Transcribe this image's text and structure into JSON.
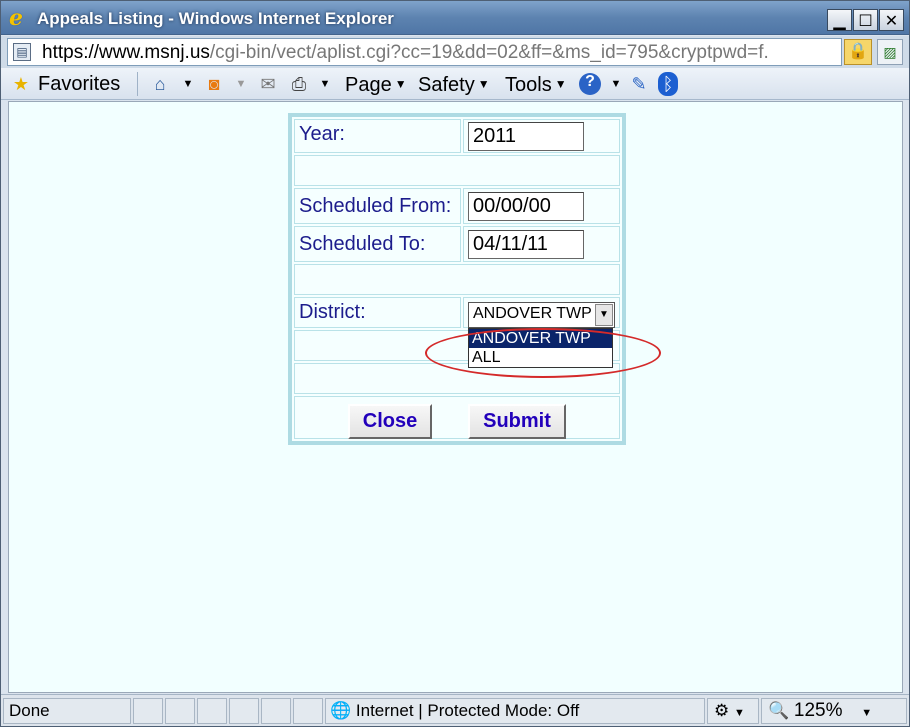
{
  "window": {
    "title": "Appeals Listing - Windows Internet Explorer"
  },
  "address": {
    "scheme": "https://www.",
    "host": "msnj.us",
    "path": "/cgi-bin/vect/aplist.cgi?cc=19&dd=02&ff=&ms_id=795&cryptpwd=f."
  },
  "command_bar": {
    "favorites": "Favorites",
    "page": "Page",
    "safety": "Safety",
    "tools": "Tools"
  },
  "form": {
    "year_label": "Year:",
    "year_value": "2011",
    "from_label": "Scheduled From:",
    "from_value": "00/00/00",
    "to_label": "Scheduled To:",
    "to_value": "04/11/11",
    "district_label": "District:",
    "district_selected": "ANDOVER TWP",
    "district_options": [
      "ANDOVER TWP",
      "ALL"
    ],
    "close_label": "Close",
    "submit_label": "Submit"
  },
  "status": {
    "text": "Done",
    "zone": "Internet | Protected Mode: Off",
    "zoom": "125%"
  },
  "colors": {
    "label": "#1c1c8c",
    "button_text": "#2200bb",
    "annotation": "#d42a2a",
    "page_bg": "#f2ffff"
  }
}
